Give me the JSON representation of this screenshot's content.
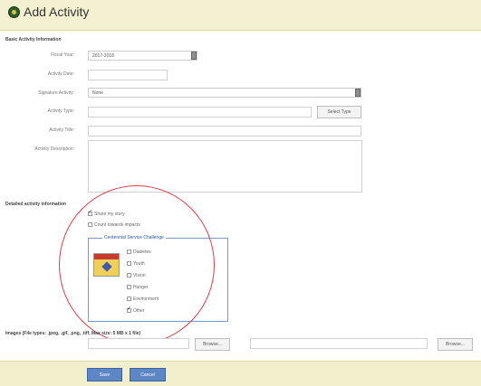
{
  "title": "Add Activity",
  "sections": {
    "basic": "Basic Activity Information",
    "detailed": "Detailed activity information",
    "images": "Images (File types: .jpeg, .gif, .png, .tiff, Max size: 5 MB x 1 file)"
  },
  "fields": {
    "fiscal_year": {
      "label": "Fiscal Year:",
      "value": "2017-2018"
    },
    "activity_date": {
      "label": "Activity Date:",
      "value": ""
    },
    "signature_activity": {
      "label": "Signature Activity:",
      "value": "None"
    },
    "activity_type": {
      "label": "Activity Type:",
      "value": ""
    },
    "activity_title": {
      "label": "Activity Title:",
      "value": ""
    },
    "activity_description": {
      "label": "Activity Description:",
      "value": ""
    }
  },
  "buttons": {
    "select_type": "Select Type",
    "browse": "Browse...",
    "save": "Save",
    "cancel": "Cancel"
  },
  "checkboxes": {
    "share_my_story": {
      "label": "Share my story",
      "checked": true
    },
    "count_towards_impacts": {
      "label": "Count towards impacts",
      "checked": false
    }
  },
  "centennial": {
    "legend": "Centennial Service Challenge",
    "items": [
      {
        "label": "Diabetes",
        "checked": false
      },
      {
        "label": "Youth",
        "checked": false
      },
      {
        "label": "Vision",
        "checked": false
      },
      {
        "label": "Hunger",
        "checked": false
      },
      {
        "label": "Environment",
        "checked": false
      },
      {
        "label": "Other",
        "checked": true
      }
    ]
  },
  "colors": {
    "header_bg": "#f3f1d2",
    "footer_bg": "#f2efcd",
    "accent_blue": "#5d86c5",
    "annotation_red": "#e03c45"
  },
  "icons": {
    "logo": "lions-logo-icon",
    "select": "dropdown-arrow-icon",
    "badge": "centennial-badge-icon"
  }
}
